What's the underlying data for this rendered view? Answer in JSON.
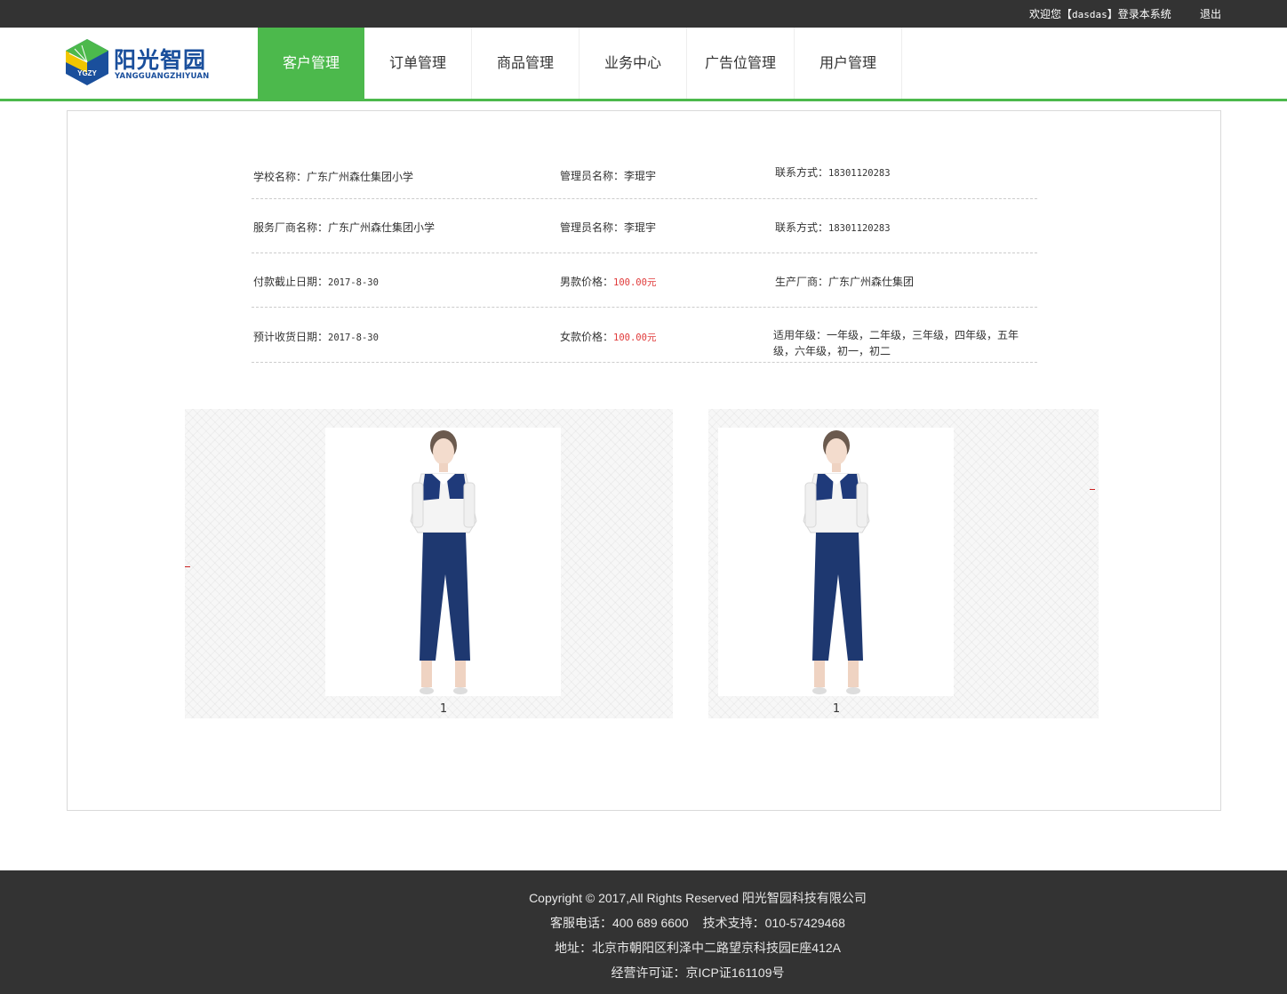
{
  "topbar": {
    "welcome_prefix": "欢迎您【",
    "username": "dasdas",
    "welcome_suffix": "】登录本系统",
    "logout": "退出"
  },
  "logo": {
    "name_cn": "阳光智园",
    "name_en": "YANGGUANGZHIYUAN",
    "badge": "YGZY",
    "colors": {
      "blue": "#1a4f9c",
      "green": "#4cb94c",
      "yellow": "#f2c600"
    }
  },
  "nav": {
    "items": [
      {
        "label": "客户管理",
        "active": true
      },
      {
        "label": "订单管理",
        "active": false
      },
      {
        "label": "商品管理",
        "active": false
      },
      {
        "label": "业务中心",
        "active": false
      },
      {
        "label": "广告位管理",
        "active": false
      },
      {
        "label": "用户管理",
        "active": false
      }
    ],
    "accent": "#4cb94c"
  },
  "info": {
    "school_label": "学校名称：",
    "school_value": "广东广州森仕集团小学",
    "admin1_label": "管理员名称：",
    "admin1_value": "李琨宇",
    "contact1_label": "联系方式：",
    "contact1_value": "18301120283",
    "vendor_label": "服务厂商名称：",
    "vendor_value": "广东广州森仕集团小学",
    "admin2_label": "管理员名称：",
    "admin2_value": "李琨宇",
    "contact2_label": "联系方式：",
    "contact2_value": "18301120283",
    "pay_deadline_label": "付款截止日期：",
    "pay_deadline_value": "2017-8-30",
    "male_price_label": "男款价格：",
    "male_price_value": "100.00元",
    "maker_label": "生产厂商：",
    "maker_value": "广东广州森仕集团",
    "delivery_label": "预计收货日期：",
    "delivery_value": "2017-8-30",
    "female_price_label": "女款价格：",
    "female_price_value": "100.00元",
    "grades_label": "适用年级：",
    "grades_value": "一年级，二年级，三年级，四年级，五年级，六年级，初一，初二",
    "price_color": "#e03a3a"
  },
  "gallery": {
    "items": [
      {
        "caption": "1",
        "image": "student-uniform-photo"
      },
      {
        "caption": "1",
        "image": "student-uniform-photo"
      }
    ]
  },
  "footer": {
    "copyright": "Copyright © 2017,All Rights Reserved 阳光智园科技有限公司",
    "service_phone": "客服电话：400 689 6600",
    "tech_support": "技术支持：010-57429468",
    "address": "地址：北京市朝阳区利泽中二路望京科技园E座412A",
    "license": "经营许可证：京ICP证161109号"
  }
}
